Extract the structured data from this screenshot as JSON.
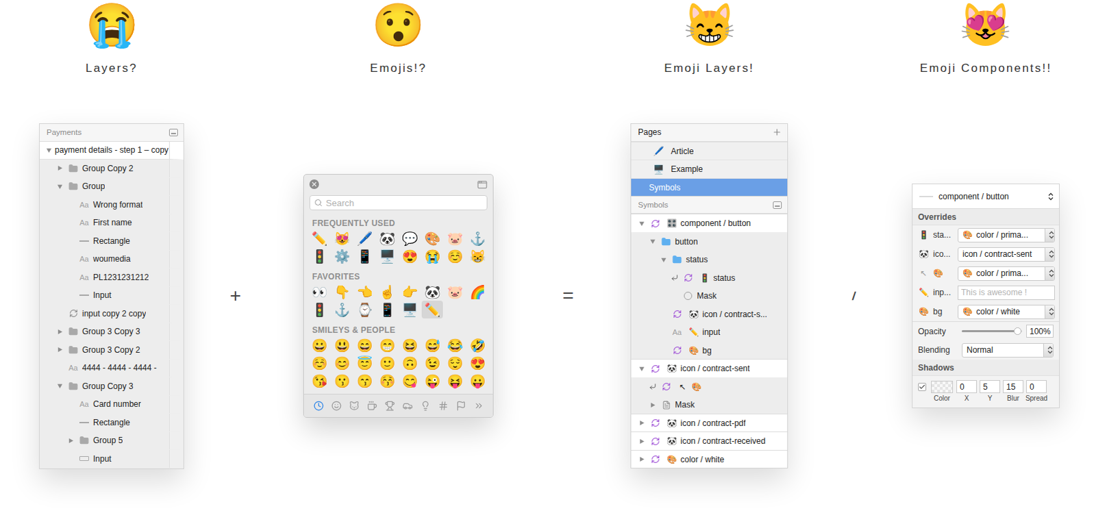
{
  "columns": [
    {
      "emoji": "😭",
      "title": "Layers?"
    },
    {
      "emoji": "😯",
      "title": "Emojis!?"
    },
    {
      "emoji": "😸",
      "title": "Emoji Layers!"
    },
    {
      "emoji": "😻",
      "title": "Emoji Components!!"
    }
  ],
  "operators": [
    "+",
    "=",
    "/"
  ],
  "layers_panel": {
    "title": "Payments",
    "text_glyph": "Aa",
    "rows": [
      {
        "name": "payment details - step 1 – copy",
        "kind": "artboard",
        "level": 0,
        "expandable": true,
        "expanded": true
      },
      {
        "name": "Group Copy 2",
        "kind": "group",
        "level": 1,
        "expandable": true,
        "expanded": false
      },
      {
        "name": "Group",
        "kind": "group",
        "level": 1,
        "expandable": true,
        "expanded": true
      },
      {
        "name": "Wrong format",
        "kind": "text",
        "level": 2,
        "expandable": false,
        "expanded": false
      },
      {
        "name": "First name",
        "kind": "text",
        "level": 2,
        "expandable": false,
        "expanded": false
      },
      {
        "name": "Rectangle",
        "kind": "shape",
        "level": 2,
        "expandable": false,
        "expanded": false
      },
      {
        "name": "woumedia",
        "kind": "text",
        "level": 2,
        "expandable": false,
        "expanded": false
      },
      {
        "name": "PL1231231212",
        "kind": "text",
        "level": 2,
        "expandable": false,
        "expanded": false
      },
      {
        "name": "Input",
        "kind": "shape",
        "level": 2,
        "expandable": false,
        "expanded": false
      },
      {
        "name": "input copy 2 copy",
        "kind": "symbol",
        "level": 1,
        "expandable": false,
        "expanded": false
      },
      {
        "name": "Group 3 Copy 3",
        "kind": "group",
        "level": 1,
        "expandable": true,
        "expanded": false
      },
      {
        "name": "Group 3 Copy 2",
        "kind": "group",
        "level": 1,
        "expandable": true,
        "expanded": false
      },
      {
        "name": "4444 - 4444 - 4444 -",
        "kind": "text",
        "level": 1,
        "expandable": false,
        "expanded": false
      },
      {
        "name": "Group Copy 3",
        "kind": "group",
        "level": 1,
        "expandable": true,
        "expanded": true
      },
      {
        "name": "Card number",
        "kind": "text",
        "level": 2,
        "expandable": false,
        "expanded": false
      },
      {
        "name": "Rectangle",
        "kind": "shape",
        "level": 2,
        "expandable": false,
        "expanded": false
      },
      {
        "name": "Group 5",
        "kind": "group",
        "level": 2,
        "expandable": true,
        "expanded": false
      },
      {
        "name": "Input",
        "kind": "rect",
        "level": 2,
        "expandable": false,
        "expanded": false
      }
    ]
  },
  "emoji_picker": {
    "search_placeholder": "Search",
    "sections": [
      {
        "label": "FREQUENTLY USED",
        "emojis": [
          {
            "char": "✏️",
            "selected": false
          },
          {
            "char": "😻",
            "selected": false
          },
          {
            "char": "🖊️",
            "selected": false
          },
          {
            "char": "🐼",
            "selected": false
          },
          {
            "char": "💬",
            "selected": false
          },
          {
            "char": "🎨",
            "selected": false
          },
          {
            "char": "🐷",
            "selected": false
          },
          {
            "char": "⚓",
            "selected": false
          },
          {
            "char": "🚦",
            "selected": false
          },
          {
            "char": "⚙️",
            "selected": false
          },
          {
            "char": "📱",
            "selected": false
          },
          {
            "char": "🖥️",
            "selected": false
          },
          {
            "char": "😍",
            "selected": false
          },
          {
            "char": "😭",
            "selected": false
          },
          {
            "char": "☺️",
            "selected": false
          },
          {
            "char": "😸",
            "selected": false
          }
        ]
      },
      {
        "label": "FAVORITES",
        "emojis": [
          {
            "char": "👀",
            "selected": false
          },
          {
            "char": "👇",
            "selected": false
          },
          {
            "char": "👈",
            "selected": false
          },
          {
            "char": "☝️",
            "selected": false
          },
          {
            "char": "👉",
            "selected": false
          },
          {
            "char": "🐼",
            "selected": false
          },
          {
            "char": "🐷",
            "selected": false
          },
          {
            "char": "🌈",
            "selected": false
          },
          {
            "char": "🚦",
            "selected": false
          },
          {
            "char": "⚓",
            "selected": false
          },
          {
            "char": "⌚",
            "selected": false
          },
          {
            "char": "📱",
            "selected": false
          },
          {
            "char": "🖥️",
            "selected": false
          },
          {
            "char": "✏️",
            "selected": true
          }
        ]
      },
      {
        "label": "SMILEYS & PEOPLE",
        "emojis": [
          {
            "char": "😀",
            "selected": false
          },
          {
            "char": "😃",
            "selected": false
          },
          {
            "char": "😄",
            "selected": false
          },
          {
            "char": "😁",
            "selected": false
          },
          {
            "char": "😆",
            "selected": false
          },
          {
            "char": "😅",
            "selected": false
          },
          {
            "char": "😂",
            "selected": false
          },
          {
            "char": "🤣",
            "selected": false
          },
          {
            "char": "☺️",
            "selected": false
          },
          {
            "char": "😊",
            "selected": false
          },
          {
            "char": "😇",
            "selected": false
          },
          {
            "char": "🙂",
            "selected": false
          },
          {
            "char": "🙃",
            "selected": false
          },
          {
            "char": "😉",
            "selected": false
          },
          {
            "char": "😌",
            "selected": false
          },
          {
            "char": "😍",
            "selected": false
          },
          {
            "char": "😘",
            "selected": false
          },
          {
            "char": "😗",
            "selected": false
          },
          {
            "char": "😙",
            "selected": false
          },
          {
            "char": "😚",
            "selected": false
          },
          {
            "char": "😋",
            "selected": false
          },
          {
            "char": "😜",
            "selected": false
          },
          {
            "char": "😝",
            "selected": false
          },
          {
            "char": "😛",
            "selected": false
          }
        ]
      }
    ],
    "category_tabs": [
      {
        "selected": true
      },
      {
        "selected": false
      },
      {
        "selected": false
      },
      {
        "selected": false
      },
      {
        "selected": false
      },
      {
        "selected": false
      },
      {
        "selected": false
      },
      {
        "selected": false
      },
      {
        "selected": false
      },
      {
        "selected": false
      }
    ]
  },
  "pages_panel": {
    "title": "Pages",
    "text_glyph": "Aa",
    "pages": [
      {
        "emoji": "🖊️",
        "name": "Article",
        "selected": false
      },
      {
        "emoji": "🖥️",
        "name": "Example",
        "selected": false
      },
      {
        "emoji": "",
        "name": "Symbols",
        "selected": true
      }
    ],
    "layers_title": "Symbols",
    "rows": [
      {
        "emoji": "🎛️",
        "name": "component / button",
        "kind": "symbol",
        "level": 0,
        "expandable": true,
        "expanded": true,
        "override": false
      },
      {
        "emoji": "",
        "name": "button",
        "kind": "folder",
        "level": 1,
        "expandable": true,
        "expanded": true,
        "override": false
      },
      {
        "emoji": "",
        "name": "status",
        "kind": "folder",
        "level": 2,
        "expandable": true,
        "expanded": true,
        "override": false
      },
      {
        "emoji": "🚦",
        "name": "status",
        "kind": "symbol",
        "level": 3,
        "expandable": false,
        "expanded": false,
        "override": true
      },
      {
        "emoji": "",
        "name": "Mask",
        "kind": "mask",
        "level": 3,
        "expandable": false,
        "expanded": false,
        "override": false
      },
      {
        "emoji": "🐼",
        "name": "icon / contract-s...",
        "kind": "symbol",
        "level": 2,
        "expandable": false,
        "expanded": false,
        "override": false
      },
      {
        "emoji": "✏️",
        "name": "input",
        "kind": "text",
        "level": 2,
        "expandable": false,
        "expanded": false,
        "override": false
      },
      {
        "emoji": "🎨",
        "name": "bg",
        "kind": "symbol",
        "level": 2,
        "expandable": false,
        "expanded": false,
        "override": false
      },
      {
        "emoji": "🐼",
        "name": "icon / contract-sent",
        "kind": "symbol",
        "level": 0,
        "expandable": true,
        "expanded": true,
        "override": false
      },
      {
        "emoji": "↖",
        "name": "🎨",
        "kind": "symbol",
        "level": 1,
        "expandable": false,
        "expanded": false,
        "override": true
      },
      {
        "emoji": "",
        "name": "Mask",
        "kind": "page",
        "level": 1,
        "expandable": true,
        "expanded": false,
        "override": false
      },
      {
        "emoji": "🐼",
        "name": "icon / contract-pdf",
        "kind": "symbol",
        "level": 0,
        "expandable": true,
        "expanded": false,
        "override": false
      },
      {
        "emoji": "🐼",
        "name": "icon / contract-received",
        "kind": "symbol",
        "level": 0,
        "expandable": true,
        "expanded": false,
        "override": false
      },
      {
        "emoji": "🎨",
        "name": "color / white",
        "kind": "symbol",
        "level": 0,
        "expandable": true,
        "expanded": false,
        "override": false
      }
    ]
  },
  "inspector": {
    "symbol": "component / button",
    "overrides_title": "Overrides",
    "overrides": [
      {
        "icon": "🚦",
        "label": "sta...",
        "kind": "select",
        "emoji": "🎨",
        "value": "color / prima..."
      },
      {
        "icon": "🐼",
        "label": "ico...",
        "kind": "select",
        "emoji": "",
        "value": "icon / contract-sent"
      },
      {
        "icon": "↖",
        "label": "🎨",
        "kind": "select",
        "emoji": "🎨",
        "value": "color / prima..."
      },
      {
        "icon": "✏️",
        "label": "inp...",
        "kind": "input",
        "emoji": "",
        "value": "This is awesome !"
      },
      {
        "icon": "🎨",
        "label": "bg",
        "kind": "select",
        "emoji": "🎨",
        "value": "color / white"
      }
    ],
    "opacity": {
      "label": "Opacity",
      "level": 0.93,
      "value": "100%"
    },
    "blending": {
      "label": "Blending",
      "value": "Normal"
    },
    "shadows": {
      "title": "Shadows",
      "enabled": true,
      "fields": [
        {
          "label": "Color",
          "value": ""
        },
        {
          "label": "X",
          "value": "0"
        },
        {
          "label": "Y",
          "value": "5"
        },
        {
          "label": "Blur",
          "value": "15"
        },
        {
          "label": "Spread",
          "value": "0"
        }
      ]
    }
  }
}
